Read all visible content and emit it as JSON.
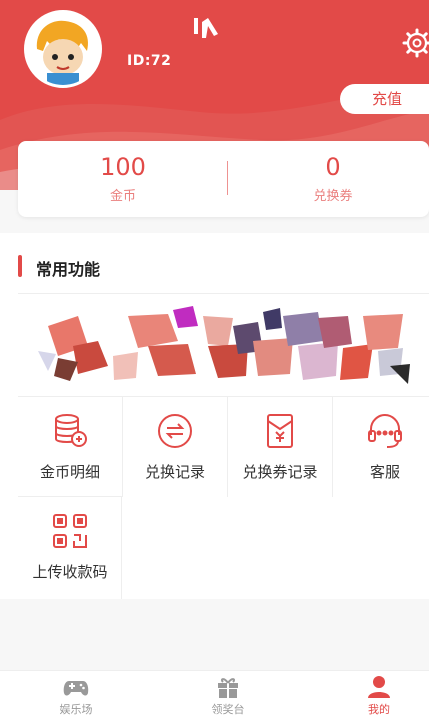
{
  "header": {
    "user_id": "ID:72",
    "recharge_label": "充值"
  },
  "stats": {
    "coins_value": "100",
    "coins_label": "金币",
    "vouchers_value": "0",
    "vouchers_label": "兑换券"
  },
  "section": {
    "title": "常用功能"
  },
  "features": [
    {
      "label": "金币明细",
      "icon": "coins-stack-icon"
    },
    {
      "label": "兑换记录",
      "icon": "exchange-icon"
    },
    {
      "label": "兑换券记录",
      "icon": "voucher-icon"
    },
    {
      "label": "客服",
      "icon": "headset-icon"
    },
    {
      "label": "上传收款码",
      "icon": "qrcode-icon"
    }
  ],
  "tabbar": {
    "items": [
      {
        "label": "娱乐场",
        "icon": "gamepad-icon"
      },
      {
        "label": "领奖台",
        "icon": "gift-icon"
      },
      {
        "label": "我的",
        "icon": "user-icon"
      }
    ]
  },
  "colors": {
    "brand": "#e24a48",
    "background": "#f7f7f7"
  }
}
